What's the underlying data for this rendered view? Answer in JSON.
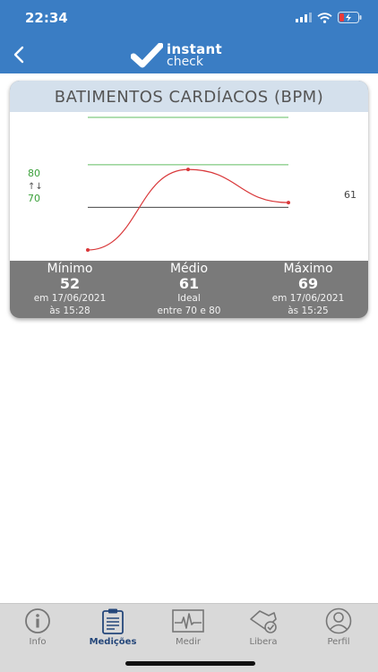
{
  "status_bar": {
    "time": "22:34"
  },
  "header": {
    "logo_line1": "instant",
    "logo_line2": "check"
  },
  "card": {
    "title": "BATIMENTOS CARDÍACOS (BPM)",
    "ideal_upper": "80",
    "ideal_arrows": "↑↓",
    "ideal_lower": "70",
    "average_label": "61"
  },
  "chart_data": {
    "type": "line",
    "title": "BATIMENTOS CARDÍACOS (BPM)",
    "series": [
      {
        "values": [
          52,
          69,
          62
        ]
      }
    ],
    "reference_lines": {
      "ideal_upper": 80,
      "ideal_lower": 70,
      "average": 61
    },
    "colors": {
      "line": "#d9383a",
      "ideal": "#62bd62",
      "average": "#444444"
    }
  },
  "stats": {
    "min": {
      "label": "Mínimo",
      "value": "52",
      "line1": "em 17/06/2021",
      "line2": "às 15:28"
    },
    "avg": {
      "label": "Médio",
      "value": "61",
      "line1": "Ideal",
      "line2": "entre 70 e 80"
    },
    "max": {
      "label": "Máximo",
      "value": "69",
      "line1": "em 17/06/2021",
      "line2": "às 15:25"
    }
  },
  "tabs": [
    {
      "label": "Info",
      "icon": "info-icon"
    },
    {
      "label": "Medições",
      "icon": "clipboard-icon"
    },
    {
      "label": "Medir",
      "icon": "ecg-icon"
    },
    {
      "label": "Libera",
      "icon": "release-icon"
    },
    {
      "label": "Perfil",
      "icon": "profile-icon"
    }
  ],
  "colors": {
    "header": "#3a7dc4",
    "active_tab": "#25477a"
  }
}
